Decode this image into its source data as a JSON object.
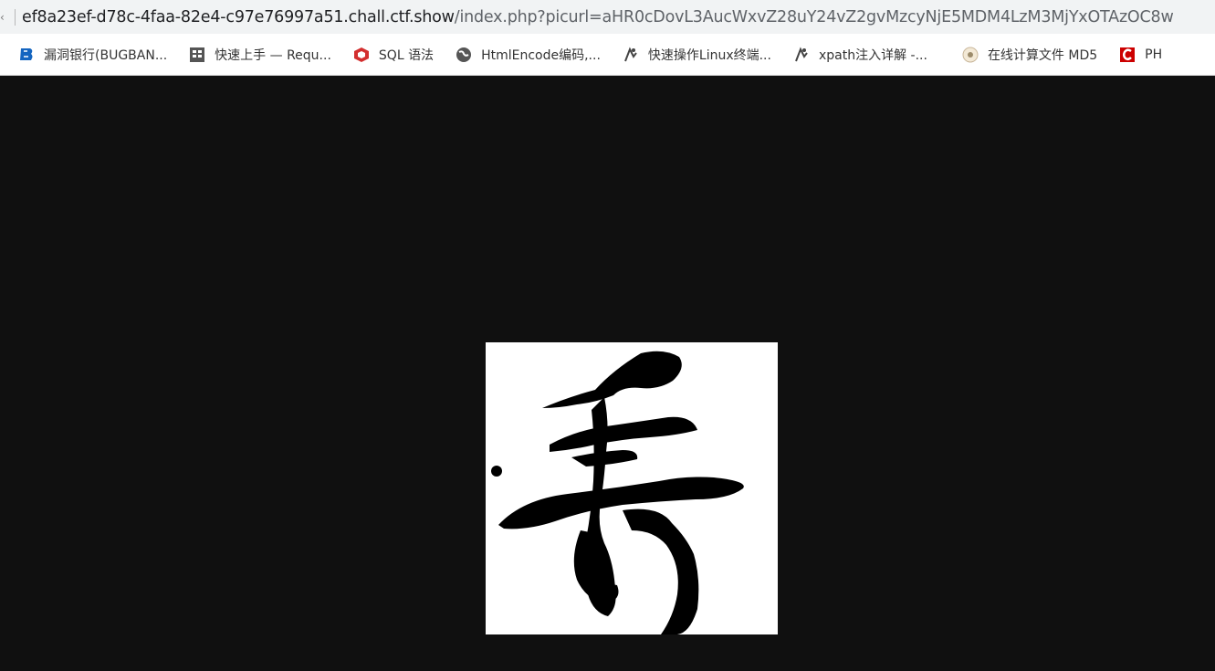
{
  "address_bar": {
    "url_host": "ef8a23ef-d78c-4faa-82e4-c97e76997a51.chall.ctf.show",
    "url_path": "/index.php?picurl=aHR0cDovL3AucWxvZ28uY24vZ2gvMzcyNjE5MDM4LzM3MjYxOTAzOC8w"
  },
  "bookmarks": [
    {
      "label": "漏洞银行(BUGBAN...",
      "icon": "bugbank-icon",
      "color": "#1565c0"
    },
    {
      "label": "快速上手 — Requ...",
      "icon": "book-icon",
      "color": "#555555"
    },
    {
      "label": "SQL 语法",
      "icon": "sql-logo-icon",
      "color": "#d32f2f"
    },
    {
      "label": "HtmlEncode编码,...",
      "icon": "globe-icon",
      "color": "#444444"
    },
    {
      "label": "快速操作Linux终端...",
      "icon": "linux-tool-icon",
      "color": "#444444"
    },
    {
      "label": "xpath注入详解 -...",
      "icon": "linux-tool-icon",
      "color": "#444444"
    },
    {
      "label": "在线计算文件 MD5",
      "icon": "md5-site-icon",
      "color": "#777777"
    },
    {
      "label": "PH",
      "icon": "php-c-icon",
      "color": "#cc0000"
    }
  ],
  "page": {
    "background": "#101010",
    "image": {
      "description_icon": "calligraphy-character-image"
    }
  }
}
